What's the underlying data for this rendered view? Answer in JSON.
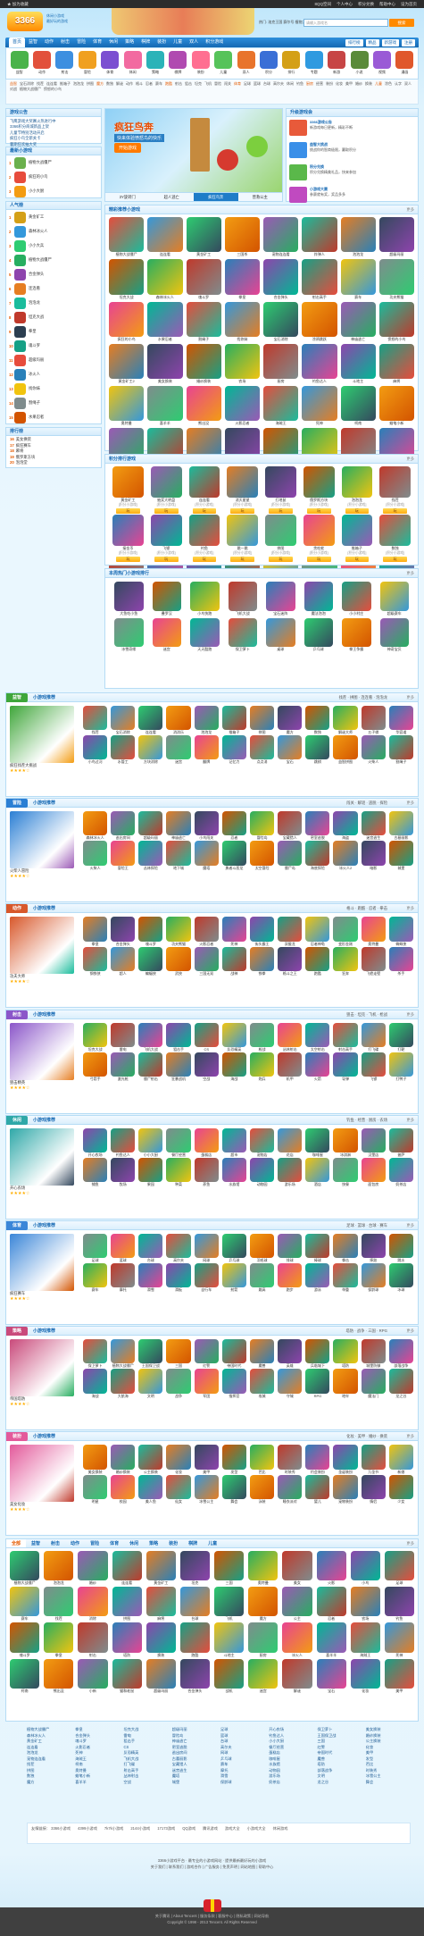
{
  "topbar": {
    "left": "★ 加为收藏",
    "right": [
      "8QQ空间",
      "个人中心",
      "积分兑换",
      "帮助中心",
      "设为首页"
    ]
  },
  "header": {
    "logo": "3366",
    "slogan1": "休闲小游戏",
    "slogan2": "最好玩的游戏",
    "search_hot": "热门: 洛克王国 赛尔号 植物大战",
    "search_placeholder": "请输入游戏名",
    "search_button": "搜索"
  },
  "nav": {
    "items": [
      "首页",
      "益智",
      "动作",
      "射击",
      "冒险",
      "体育",
      "休闲",
      "策略",
      "棋牌",
      "装扮",
      "儿童",
      "双人",
      "积分游戏"
    ],
    "right": [
      "排行榜",
      "精品",
      "新游戏"
    ],
    "register": "注册"
  },
  "catrow": [
    {
      "t": "益智",
      "color": "#4ab34a"
    },
    {
      "t": "动作",
      "color": "#e2503b"
    },
    {
      "t": "射击",
      "color": "#3d8fe0"
    },
    {
      "t": "冒险",
      "color": "#f0a020"
    },
    {
      "t": "体育",
      "color": "#7b4fd1"
    },
    {
      "t": "休闲",
      "color": "#f26aa0"
    },
    {
      "t": "策略",
      "color": "#2bb3b8"
    },
    {
      "t": "棋牌",
      "color": "#b04ab0"
    },
    {
      "t": "装扮",
      "color": "#ff6f91"
    },
    {
      "t": "儿童",
      "color": "#56c35a"
    },
    {
      "t": "双人",
      "color": "#e8742c"
    },
    {
      "t": "积分",
      "color": "#3a6fd6"
    },
    {
      "t": "排行",
      "color": "#d4a017"
    },
    {
      "t": "专题",
      "color": "#2f9ae0"
    },
    {
      "t": "新游",
      "color": "#c74545"
    },
    {
      "t": "小说",
      "color": "#5a8a3a"
    },
    {
      "t": "视频",
      "color": "#9a5ad6"
    },
    {
      "t": "漫画",
      "color": "#e0582c"
    }
  ],
  "tags": [
    "益智",
    "宝石消除",
    "找茬",
    "连连看",
    "推箱子",
    "泡泡龙",
    "拼图",
    "魔方",
    "数独",
    "解谜",
    "动作",
    "格斗",
    "忍者",
    "赛车",
    "跑酷",
    "射击",
    "狙击",
    "坦克",
    "飞机",
    "冒险",
    "闯关",
    "体育",
    "足球",
    "篮球",
    "台球",
    "高尔夫",
    "休闲",
    "钓鱼",
    "厨房",
    "经营",
    "装扮",
    "化妆",
    "美甲",
    "婚纱",
    "换装",
    "儿童",
    "涂色",
    "认字",
    "双人",
    "对战",
    "植物大战僵尸",
    "愤怒的小鸟"
  ],
  "left": {
    "notice_title": "游戏公告",
    "notice": [
      "飞鹰游戏大奖赛火热进行中",
      "3366积分商城新品上架",
      "儿童节特别活动开启",
      "疯狂小鸟全新关卡",
      "暑期狂欢抽大奖"
    ],
    "hot_title": "最新小游戏",
    "hot": [
      {
        "n": "1",
        "t": "植物大战僵尸",
        "color": "#6ab04c"
      },
      {
        "n": "2",
        "t": "疯狂的小鸟",
        "color": "#e74c3c"
      },
      {
        "n": "3",
        "t": "小小大厨",
        "color": "#f39c12"
      }
    ],
    "rank_title": "人气榜",
    "rank": [
      {
        "n": "1",
        "t": "黄金矿工",
        "color": "#d4a017"
      },
      {
        "n": "2",
        "t": "森林冰火人",
        "color": "#3498db"
      },
      {
        "n": "3",
        "t": "小小大兵",
        "color": "#2ecc71"
      },
      {
        "n": "4",
        "t": "植物大战僵尸",
        "color": "#27ae60"
      },
      {
        "n": "5",
        "t": "合金弹头",
        "color": "#8e44ad"
      },
      {
        "n": "6",
        "t": "连连看",
        "color": "#e67e22"
      },
      {
        "n": "7",
        "t": "泡泡龙",
        "color": "#1abc9c"
      },
      {
        "n": "8",
        "t": "坦克大战",
        "color": "#c0392b"
      },
      {
        "n": "9",
        "t": "拳皇",
        "color": "#2c3e50"
      },
      {
        "n": "10",
        "t": "魂斗罗",
        "color": "#16a085"
      },
      {
        "n": "11",
        "t": "超级玛丽",
        "color": "#e74c3c"
      },
      {
        "n": "12",
        "t": "冰火人",
        "color": "#2980b9"
      },
      {
        "n": "13",
        "t": "找你妹",
        "color": "#f1c40f"
      },
      {
        "n": "14",
        "t": "割绳子",
        "color": "#7f8c8d"
      },
      {
        "n": "15",
        "t": "水果忍者",
        "color": "#d35400"
      }
    ],
    "more_title": "排行榜",
    "more": [
      {
        "n": "16",
        "t": "美女换装"
      },
      {
        "n": "17",
        "t": "疯狂赛车"
      },
      {
        "n": "18",
        "t": "麻将"
      },
      {
        "n": "19",
        "t": "俄罗斯方块"
      },
      {
        "n": "20",
        "t": "泡泡堂"
      }
    ]
  },
  "banner": {
    "title": "疯狂鸟奔",
    "subtitle": "快来体验愤怒鸟的快乐",
    "button": "开始游戏",
    "tabs": [
      "3Y旋转门",
      "超人逃亡",
      "疯狂鸟奔",
      "营救公主"
    ]
  },
  "rightbox": {
    "title": "升级游戏会",
    "items": [
      {
        "b": "3366游戏公告",
        "t": "新游戏每日更新，精彩不断",
        "color": "#e85a3a"
      },
      {
        "b": "益智大挑战",
        "t": "挑战你的智商极限，赢取积分",
        "color": "#3a8fe8"
      },
      {
        "b": "积分兑换",
        "t": "积分兑换精美礼品，快来参加",
        "color": "#5ab84a"
      },
      {
        "b": "小游戏大赛",
        "t": "参赛就有奖，奖品多多",
        "color": "#c04ac0"
      }
    ]
  },
  "main_grid": {
    "title": "精彩推荐小游戏",
    "more": "更多",
    "rows": [
      [
        "植物大战僵尸",
        "连连看",
        "黄金矿工",
        "三国杀",
        "宠物连连看",
        "炸弹人",
        "泡泡龙",
        "超级玛丽"
      ],
      [
        "坦克大战",
        "森林冰火人",
        "魂斗罗",
        "拳皇",
        "合金弹头",
        "射击高手",
        "赛车",
        "功夫熊猫"
      ],
      [
        "疯狂的小鸟",
        "水果忍者",
        "割绳子",
        "找你妹",
        "宝石消除",
        "涂鸦跳跃",
        "神庙逃亡",
        "愤怒的小鸟"
      ],
      [
        "黄金矿工2",
        "美女换装",
        "婚纱换装",
        "农场",
        "厨房",
        "钓鱼达人",
        "斗地主",
        "麻将"
      ],
      [
        "奥特曼",
        "喜羊羊",
        "熊出没",
        "火影忍者",
        "海贼王",
        "死神",
        "柯南",
        "蜡笔小新"
      ],
      [
        "狂暴战机",
        "坦克动荡",
        "丛林射击",
        "反恐精英",
        "CS",
        "枪战",
        "狙击手",
        "飞刀"
      ],
      [
        "冰火人",
        "机器人",
        "拳击",
        "足球",
        "篮球",
        "台球",
        "高尔夫",
        "网球"
      ],
      [
        "洛克王国",
        "赛尔号",
        "摩尔庄园",
        "奥拉星",
        "龙斗士",
        "功夫派",
        "弹弹堂",
        "QQ飞车"
      ],
      [
        "羊羊运动会",
        "小小大厨",
        "疯狂赛车",
        "海底捕鱼",
        "开心消消",
        "果宝特攻",
        "猫和老鼠",
        "小猪佩奇"
      ]
    ]
  },
  "gold_grid": {
    "title": "积分排行游戏",
    "more": "更多",
    "items": [
      {
        "t": "黄金矿工",
        "c": "[积分小游戏]",
        "b": "玩"
      },
      {
        "t": "抽奖大转盘",
        "c": "[积分小游戏]",
        "b": "玩"
      },
      {
        "t": "连连看",
        "c": "[积分小游戏]",
        "b": "玩"
      },
      {
        "t": "消灭星星",
        "c": "[积分小游戏]",
        "b": "玩"
      },
      {
        "t": "打地鼠",
        "c": "[积分小游戏]",
        "b": "玩"
      },
      {
        "t": "俄罗斯方块",
        "c": "[积分小游戏]",
        "b": "玩"
      },
      {
        "t": "泡泡龙",
        "c": "[积分小游戏]",
        "b": "玩"
      },
      {
        "t": "找茬",
        "c": "[积分小游戏]",
        "b": "玩"
      },
      {
        "t": "接金币",
        "c": "[积分小游戏]",
        "b": "玩"
      },
      {
        "t": "飞镖",
        "c": "[积分小游戏]",
        "b": "玩"
      },
      {
        "t": "钓鱼",
        "c": "[积分小游戏]",
        "b": "玩"
      },
      {
        "t": "跳一跳",
        "c": "[积分小游戏]",
        "b": "玩"
      },
      {
        "t": "拼图",
        "c": "[积分小游戏]",
        "b": "玩"
      },
      {
        "t": "贪吃蛇",
        "c": "[积分小游戏]",
        "b": "玩"
      },
      {
        "t": "推箱子",
        "c": "[积分小游戏]",
        "b": "玩"
      },
      {
        "t": "数独",
        "c": "[积分小游戏]",
        "b": "玩"
      }
    ]
  },
  "special": {
    "title": "本周热门小游戏排行",
    "more": "更多",
    "items": [
      "大鱼吃小鱼",
      "叠罗汉",
      "小鸟快跑",
      "飞机大战",
      "宝石迷阵",
      "魔法泡泡",
      "小小村庄",
      "超级赛车",
      "冰雪奇缘",
      "迷宫",
      "天天酷跑",
      "保卫萝卜",
      "桌球",
      "乒乓球",
      "拳王争霸",
      "神奇宝贝"
    ]
  },
  "sections": [
    {
      "key": "yizhi",
      "label": "益智",
      "color": "#3fa63a",
      "title": "小游戏推荐",
      "tags": "找茬 · 拼图 · 连连看 · 泡泡龙",
      "feat": "疯狂找茬大挑战",
      "more": "更多",
      "items": [
        "找茬",
        "宝石消除",
        "连连看",
        "消消乐",
        "泡泡龙",
        "推箱子",
        "拼图",
        "魔方",
        "数独",
        "解谜大师",
        "五子棋",
        "华容道",
        "小鸟过河",
        "水管工",
        "方块消除",
        "迷宫",
        "翻牌",
        "记忆力",
        "点点消",
        "宝石",
        "跳棋",
        "益智拼图",
        "火柴人",
        "割绳子"
      ]
    },
    {
      "key": "maoxian",
      "label": "冒险",
      "color": "#2b7fd4",
      "title": "小游戏推荐",
      "tags": "闯关 · 解谜 · 逃脱 · 探险",
      "feat": "火柴人冒险",
      "more": "更多",
      "items": [
        "森林冰火人",
        "逃出房间",
        "超级玛丽",
        "神庙逃亡",
        "小鸟闯关",
        "忍者",
        "冒险岛",
        "宝藏猎人",
        "密室逃脱",
        "海盗",
        "迷宫逃生",
        "古墓丽影",
        "火柴人",
        "冒险王",
        "丛林探险",
        "地下城",
        "魔塔",
        "勇者斗恶龙",
        "太空冒险",
        "僵尸岛",
        "海底探险",
        "冰火人2",
        "暗影",
        "城堡"
      ]
    },
    {
      "key": "dongzuo",
      "label": "动作",
      "color": "#d8582b",
      "title": "小游戏推荐",
      "tags": "格斗 · 跑酷 · 忍者 · 拳击",
      "feat": "功夫大师",
      "more": "更多",
      "items": [
        "拳皇",
        "合金弹头",
        "魂斗罗",
        "功夫熊猫",
        "火影忍者",
        "死神",
        "街头霸王",
        "双截龙",
        "忍者神龟",
        "变形金刚",
        "奥特曼",
        "蜘蛛侠",
        "钢铁侠",
        "超人",
        "蝙蝠侠",
        "武侠",
        "三国无双",
        "战神",
        "铁拳",
        "格斗之王",
        "跑酷",
        "狂奔",
        "飞檐走壁",
        "杀手"
      ]
    },
    {
      "key": "sheji",
      "label": "射击",
      "color": "#8b56c9",
      "title": "小游戏推荐",
      "tags": "狙击 · 坦克 · 飞机 · 枪战",
      "feat": "狙击精英",
      "more": "更多",
      "items": [
        "坦克大战",
        "雷电",
        "飞机大战",
        "狙击手",
        "CS",
        "反恐精英",
        "枪战",
        "丛林射击",
        "太空射击",
        "射击高手",
        "打飞碟",
        "打靶",
        "弓箭手",
        "激光枪",
        "僵尸射击",
        "狂暴战机",
        "空战",
        "海战",
        "炮兵",
        "机甲",
        "火箭",
        "导弹",
        "飞镖",
        "打鸭子"
      ]
    },
    {
      "key": "xiuxian",
      "label": "休闲",
      "color": "#2fa8a8",
      "title": "小游戏推荐",
      "tags": "钓鱼 · 经营 · 厨房 · 农场",
      "feat": "开心农场",
      "more": "更多",
      "items": [
        "开心农场",
        "钓鱼达人",
        "小小大厨",
        "餐厅经营",
        "蛋糕店",
        "超市",
        "宠物店",
        "花店",
        "咖啡屋",
        "冰淇淋",
        "汉堡店",
        "披萨",
        "捕鱼",
        "牧场",
        "果园",
        "种菜",
        "养鱼",
        "水族馆",
        "动物园",
        "游乐场",
        "酒店",
        "快餐",
        "面包房",
        "奶茶店"
      ]
    },
    {
      "key": "tiyu",
      "label": "体育",
      "color": "#3b86d8",
      "title": "小游戏推荐",
      "tags": "足球 · 篮球 · 台球 · 赛车",
      "feat": "疯狂赛车",
      "more": "更多",
      "items": [
        "足球",
        "篮球",
        "台球",
        "高尔夫",
        "网球",
        "乒乓球",
        "羽毛球",
        "排球",
        "棒球",
        "拳击",
        "摔跤",
        "跳水",
        "赛车",
        "摩托",
        "滑雪",
        "滑板",
        "自行车",
        "射箭",
        "跳高",
        "跑步",
        "游泳",
        "举重",
        "保龄球",
        "冰球"
      ]
    },
    {
      "key": "celue",
      "label": "策略",
      "color": "#c94a7b",
      "title": "小游戏推荐",
      "tags": "塔防 · 战争 · 三国 · RPG",
      "feat": "帝国塔防",
      "more": "更多",
      "items": [
        "保卫萝卜",
        "植物大战僵尸",
        "王国保卫战",
        "三国",
        "红警",
        "帝国时代",
        "魔兽",
        "英雄",
        "兵临城下",
        "塔防",
        "城堡防御",
        "部落战争",
        "海战",
        "大航海",
        "文明",
        "战争",
        "军团",
        "指挥官",
        "攻城",
        "守城",
        "RPG",
        "地牢",
        "魔法门",
        "龙之谷"
      ]
    },
    {
      "key": "zhuangban",
      "label": "装扮",
      "color": "#e35a9b",
      "title": "小游戏推荐",
      "tags": "化妆 · 美甲 · 婚纱 · 换装",
      "feat": "美女化妆",
      "more": "更多",
      "items": [
        "美女换装",
        "婚纱换装",
        "公主换装",
        "化妆",
        "美甲",
        "发型",
        "芭比",
        "时装秀",
        "约会装扮",
        "圣诞装扮",
        "万圣节",
        "新娘",
        "明星",
        "校园",
        "美人鱼",
        "仙女",
        "冰雪公主",
        "舞会",
        "泳装",
        "睡衣派对",
        "婴儿",
        "宠物装扮",
        "情侣",
        "少女"
      ]
    }
  ],
  "bottom": {
    "tabs": [
      "全部",
      "益智",
      "射击",
      "动作",
      "冒险",
      "体育",
      "休闲",
      "策略",
      "装扮",
      "棋牌",
      "儿童"
    ],
    "more": "更多",
    "items": [
      "植物大战僵尸",
      "泡泡龙",
      "婚纱",
      "连连看",
      "黄金矿工",
      "坦克",
      "三国",
      "奥特曼",
      "美女",
      "火影",
      "小鸟",
      "足球",
      "赛车",
      "找茬",
      "消除",
      "拼图",
      "麻将",
      "台球",
      "飞机",
      "魔方",
      "公主",
      "忍者",
      "农场",
      "钓鱼",
      "魂斗罗",
      "拳皇",
      "射击",
      "塔防",
      "换装",
      "跑酷",
      "斗地主",
      "厨房",
      "冰火人",
      "喜羊羊",
      "海贼王",
      "死神",
      "柯南",
      "熊出没",
      "小新",
      "猫和老鼠",
      "超级玛丽",
      "合金弹头",
      "战机",
      "迷宫",
      "解谜",
      "宝石",
      "化妆",
      "美甲"
    ]
  },
  "links": [
    [
      "植物大战僵尸",
      "森林冰火人",
      "黄金矿工",
      "连连看",
      "泡泡龙",
      "宠物连连看",
      "找茬",
      "拼图",
      "数独",
      "魔方"
    ],
    [
      "拳皇",
      "合金弹头",
      "魂斗罗",
      "火影忍者",
      "死神",
      "海贼王",
      "柯南",
      "奥特曼",
      "蜡笔小新",
      "喜羊羊"
    ],
    [
      "坦克大战",
      "雷电",
      "狙击手",
      "CS",
      "反恐精英",
      "飞机大战",
      "打飞碟",
      "射击高手",
      "丛林射击",
      "空战"
    ],
    [
      "超级玛丽",
      "冒险岛",
      "神庙逃亡",
      "密室逃脱",
      "逃出房间",
      "古墓丽影",
      "宝藏猎人",
      "迷宫逃生",
      "魔塔",
      "城堡"
    ],
    [
      "足球",
      "篮球",
      "台球",
      "高尔夫",
      "网球",
      "乒乓球",
      "赛车",
      "摩托",
      "滑雪",
      "保龄球"
    ],
    [
      "开心农场",
      "钓鱼达人",
      "小小大厨",
      "餐厅经营",
      "蛋糕店",
      "咖啡屋",
      "水族馆",
      "动物园",
      "游乐场",
      "奶茶店"
    ],
    [
      "保卫萝卜",
      "王国保卫战",
      "三国",
      "红警",
      "帝国时代",
      "魔兽",
      "塔防",
      "部落战争",
      "文明",
      "龙之谷"
    ],
    [
      "美女换装",
      "婚纱换装",
      "公主换装",
      "化妆",
      "美甲",
      "发型",
      "芭比",
      "时装秀",
      "冰雪公主",
      "舞会"
    ]
  ],
  "friend": {
    "title": "友情链接：",
    "items": [
      "3366小游戏",
      "4399小游戏",
      "7k7k小游戏",
      "2144小游戏",
      "17173游戏",
      "QQ游戏",
      "腾讯游戏",
      "游戏大全",
      "小游戏大全",
      "休闲游戏"
    ]
  },
  "footer": {
    "lines": [
      "3366小游戏平台 · 最专业的小游戏网站 · 提供最新最好玩的小游戏",
      "关于我们 | 联系我们 | 游戏合作 | 广告服务 | 免责声明 | 网站地图 | 帮助中心"
    ],
    "bar": [
      "关于腾讯 | About Tencent | 服务条款 | 客服中心 | 隐私政策 | 网站导航",
      "Copyright © 1998 - 2013 Tencent. All Rights Reserved"
    ]
  },
  "palette": [
    "#e74c3c",
    "#3498db",
    "#2ecc71",
    "#f39c12",
    "#9b59b6",
    "#1abc9c",
    "#e67e22",
    "#34495e",
    "#d35400",
    "#27ae60",
    "#c0392b",
    "#2980b9",
    "#8e44ad",
    "#16a085",
    "#f1c40f",
    "#7f8c8d",
    "#e84393",
    "#00b894"
  ]
}
